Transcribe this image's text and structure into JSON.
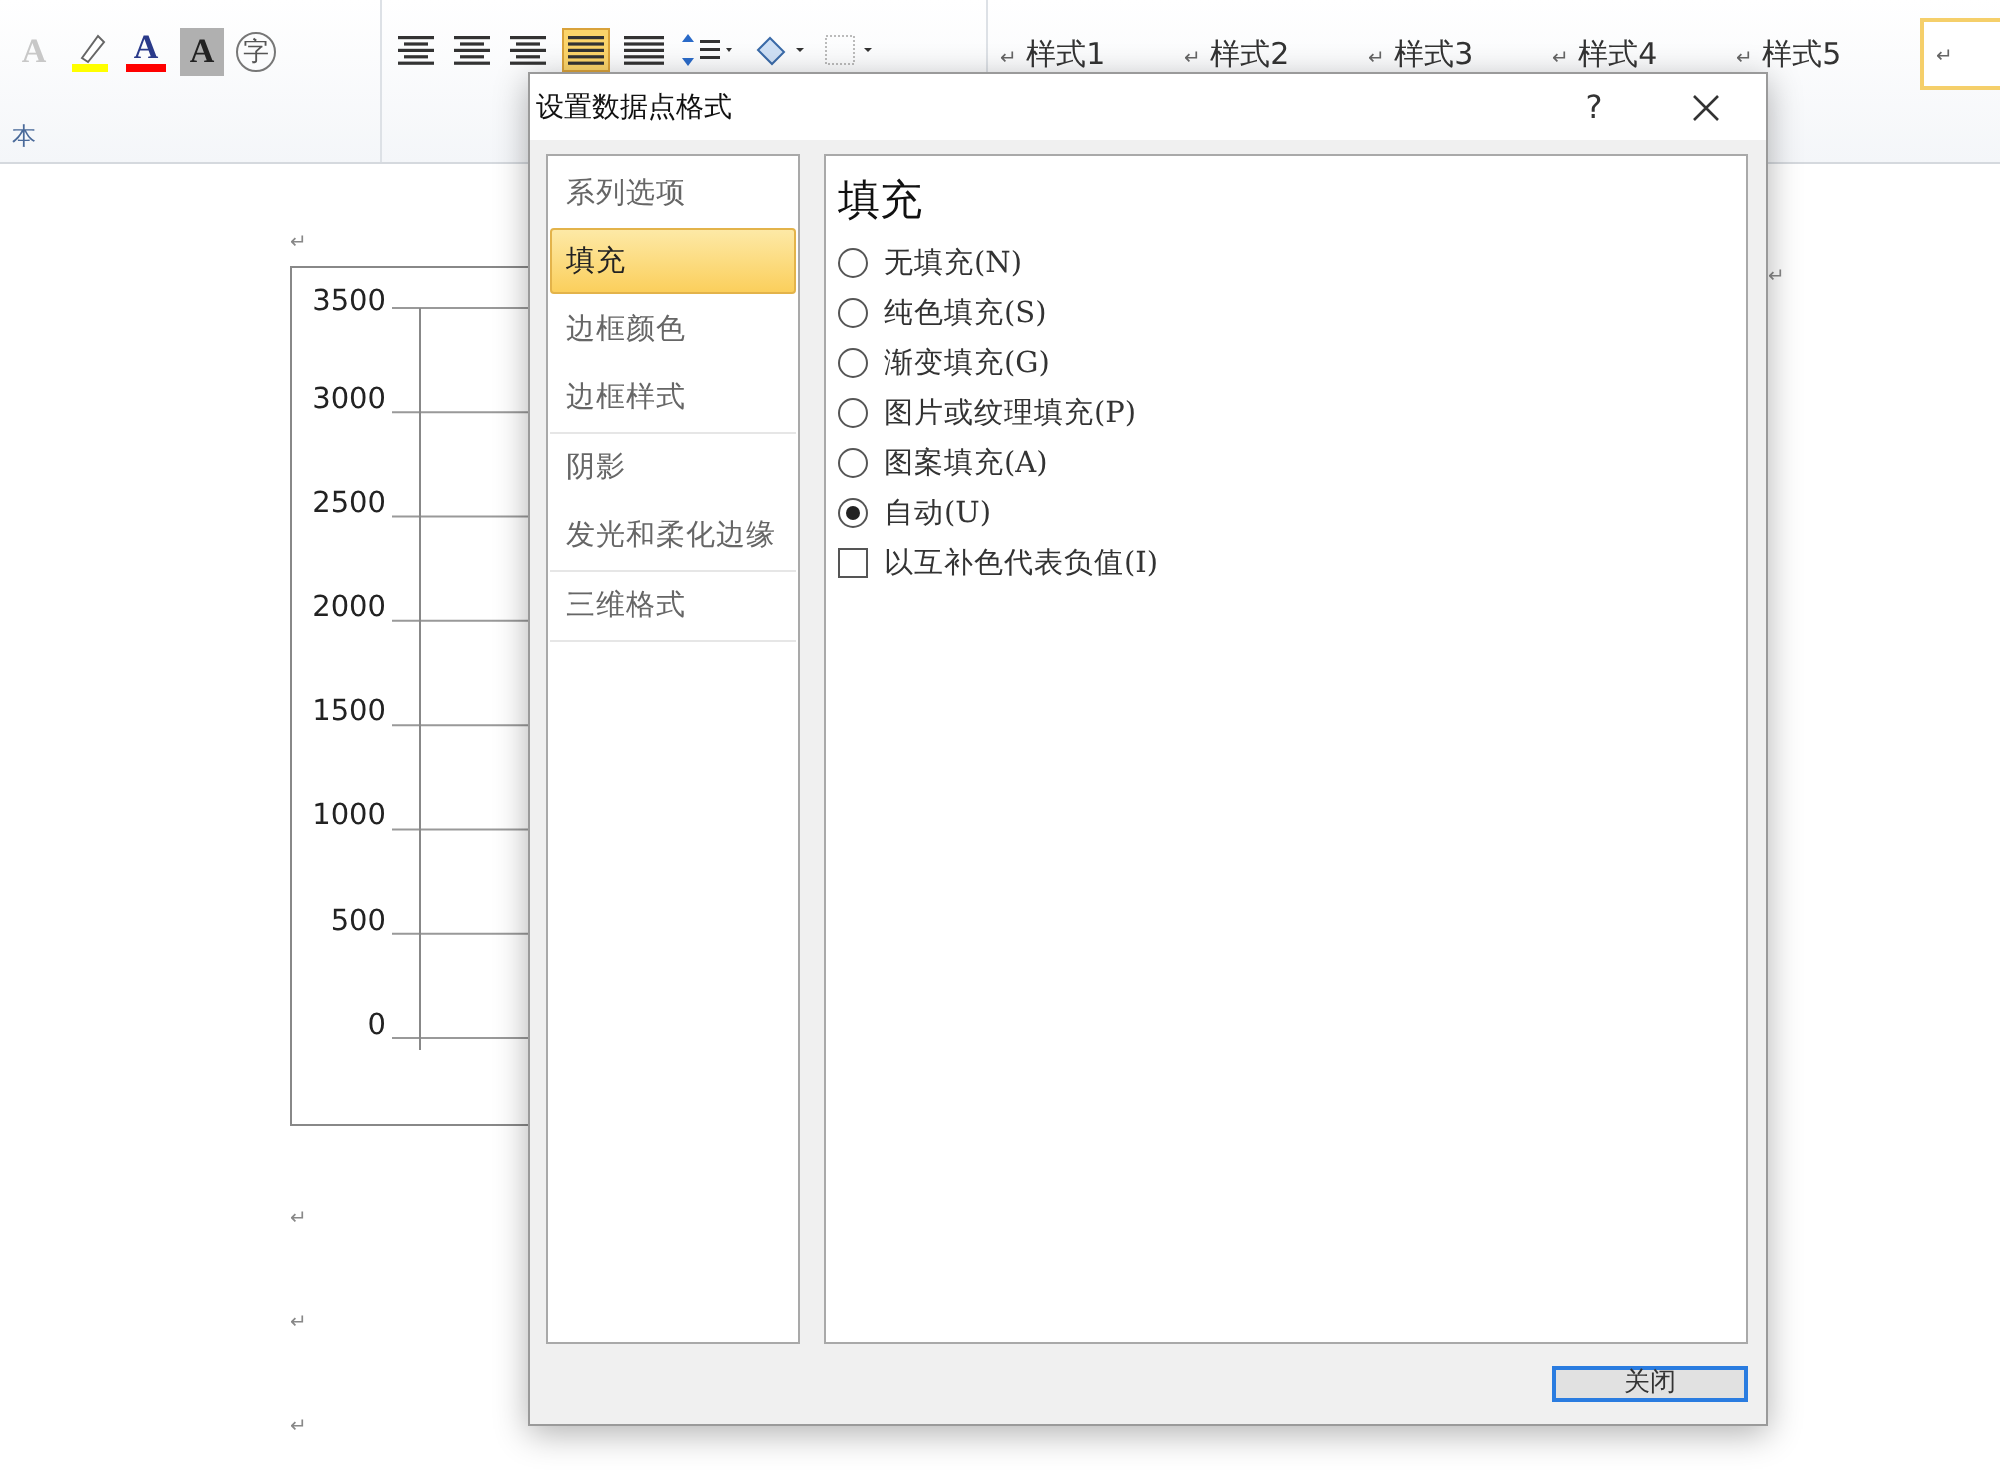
{
  "ribbon": {
    "font_tools": [
      {
        "kind": "text-effect",
        "glyph": "A",
        "disabled": true
      },
      {
        "kind": "highlight"
      },
      {
        "kind": "font-color",
        "glyph": "A"
      },
      {
        "kind": "shading",
        "glyph": "A"
      },
      {
        "kind": "enclose",
        "glyph": "字"
      }
    ],
    "font_group_label": "本",
    "styles": [
      {
        "label": "样式1",
        "mark": "↵"
      },
      {
        "label": "样式2",
        "mark": "↵"
      },
      {
        "label": "样式3",
        "mark": "↵"
      },
      {
        "label": "样式4",
        "mark": "↵"
      },
      {
        "label": "样式5",
        "mark": "↵"
      },
      {
        "mark": "↵"
      }
    ]
  },
  "document": {
    "marks_before": [
      "↵"
    ],
    "marks_after": [
      "↵",
      "↵",
      "↵"
    ],
    "chart_end_mark": "↵",
    "chart": {
      "y_axis_labels": [
        "3500",
        "3000",
        "2500",
        "2000",
        "1500",
        "1000",
        "500",
        "0"
      ]
    }
  },
  "dialog": {
    "title": "设置数据点格式",
    "help": "?",
    "nav_groups": [
      [
        {
          "label": "系列选项",
          "selected": false
        },
        {
          "label": "填充",
          "selected": true
        },
        {
          "label": "边框颜色",
          "selected": false
        },
        {
          "label": "边框样式",
          "selected": false
        }
      ],
      [
        {
          "label": "阴影",
          "selected": false
        },
        {
          "label": "发光和柔化边缘",
          "selected": false
        }
      ],
      [
        {
          "label": "三维格式",
          "selected": false
        }
      ]
    ],
    "heading": "填充",
    "options": [
      {
        "label": "无填充(N)",
        "selected": false
      },
      {
        "label": "纯色填充(S)",
        "selected": false
      },
      {
        "label": "渐变填充(G)",
        "selected": false
      },
      {
        "label": "图片或纹理填充(P)",
        "selected": false
      },
      {
        "label": "图案填充(A)",
        "selected": false
      },
      {
        "label": "自动(U)",
        "selected": true
      }
    ],
    "checkbox": {
      "label": "以互补色代表负值(I)",
      "checked": false
    },
    "close_button": "关闭"
  }
}
